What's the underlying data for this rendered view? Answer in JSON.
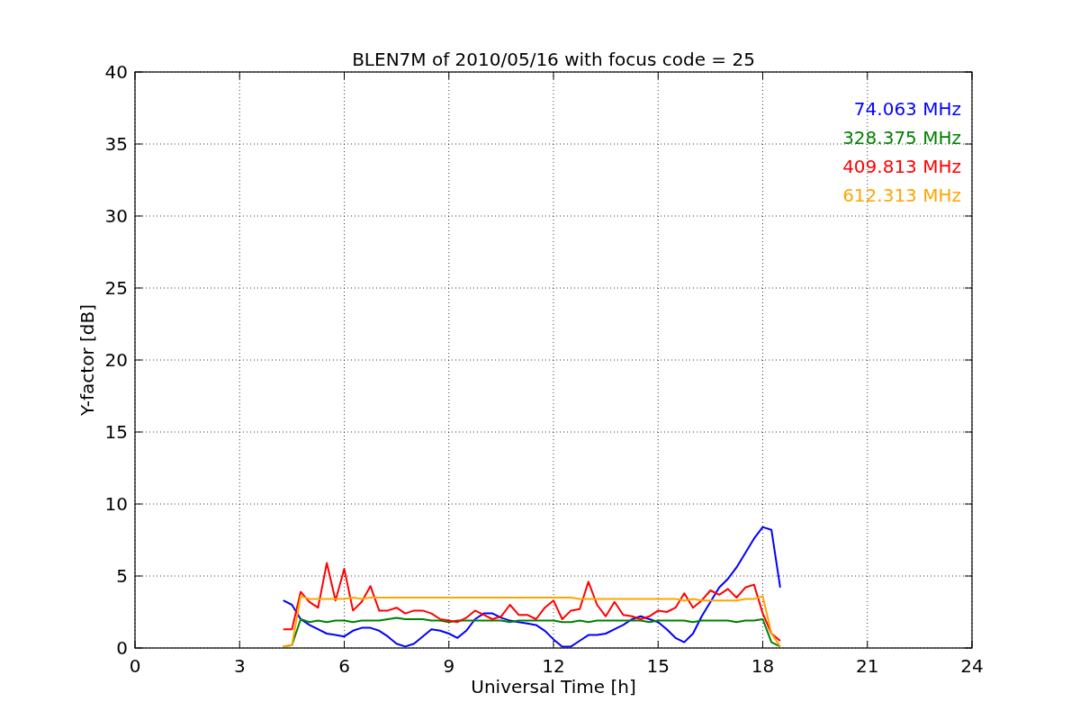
{
  "chart_data": {
    "type": "line",
    "title": "BLEN7M of 2010/05/16 with focus code = 25",
    "xlabel": "Universal Time [h]",
    "ylabel": "Y-factor [dB]",
    "xlim": [
      0,
      24
    ],
    "ylim": [
      0,
      40
    ],
    "xticks": [
      0,
      3,
      6,
      9,
      12,
      15,
      18,
      21,
      24
    ],
    "yticks": [
      0,
      5,
      10,
      15,
      20,
      25,
      30,
      35,
      40
    ],
    "grid": true,
    "x": [
      4.25,
      4.5,
      4.75,
      5,
      5.25,
      5.5,
      5.75,
      6,
      6.25,
      6.5,
      6.75,
      7,
      7.25,
      7.5,
      7.75,
      8,
      8.25,
      8.5,
      8.75,
      9,
      9.25,
      9.5,
      9.75,
      10,
      10.25,
      10.5,
      10.75,
      11,
      11.25,
      11.5,
      11.75,
      12,
      12.25,
      12.5,
      12.75,
      13,
      13.25,
      13.5,
      13.75,
      14,
      14.25,
      14.5,
      14.75,
      15,
      15.25,
      15.5,
      15.75,
      16,
      16.25,
      16.5,
      16.75,
      17,
      17.25,
      17.5,
      17.75,
      18,
      18.25,
      18.5
    ],
    "series": [
      {
        "name": "74.063 MHz",
        "color": "#0000ff",
        "values": [
          3.3,
          3.0,
          2.0,
          1.6,
          1.3,
          1.0,
          0.9,
          0.8,
          1.2,
          1.4,
          1.4,
          1.2,
          0.8,
          0.3,
          0.1,
          0.3,
          0.8,
          1.3,
          1.2,
          1.0,
          0.7,
          1.2,
          2.0,
          2.4,
          2.4,
          2.1,
          1.9,
          1.8,
          1.7,
          1.6,
          1.2,
          0.6,
          0.1,
          0.1,
          0.5,
          0.9,
          0.9,
          1.0,
          1.3,
          1.6,
          2.0,
          2.2,
          2.0,
          1.8,
          1.3,
          0.7,
          0.4,
          1.0,
          2.2,
          3.2,
          4.2,
          4.8,
          5.6,
          6.6,
          7.6,
          8.4,
          8.2,
          4.2
        ]
      },
      {
        "name": "328.375 MHz",
        "color": "#008000",
        "values": [
          0.1,
          0.2,
          2.0,
          1.8,
          1.9,
          1.8,
          1.9,
          1.9,
          1.8,
          1.9,
          1.9,
          1.9,
          2.0,
          2.1,
          2.0,
          2.0,
          2.0,
          1.9,
          1.9,
          1.8,
          1.9,
          1.9,
          1.9,
          1.9,
          1.9,
          1.9,
          1.8,
          1.9,
          1.9,
          1.9,
          1.9,
          1.9,
          1.8,
          1.8,
          1.9,
          1.8,
          1.9,
          1.9,
          1.9,
          1.9,
          1.9,
          1.9,
          1.8,
          1.9,
          1.9,
          1.9,
          1.9,
          1.8,
          1.9,
          1.9,
          1.9,
          1.9,
          1.8,
          1.9,
          1.9,
          2.0,
          0.4,
          0.1
        ]
      },
      {
        "name": "409.813 MHz",
        "color": "#ff0000",
        "values": [
          1.3,
          1.3,
          3.9,
          3.2,
          2.8,
          5.9,
          3.3,
          5.5,
          2.6,
          3.2,
          4.3,
          2.6,
          2.6,
          2.8,
          2.4,
          2.6,
          2.6,
          2.4,
          2.0,
          1.9,
          1.8,
          2.1,
          2.6,
          2.3,
          2.0,
          2.2,
          3.0,
          2.3,
          2.3,
          2.0,
          2.8,
          3.3,
          2.0,
          2.6,
          2.7,
          4.6,
          3.0,
          2.2,
          3.2,
          2.3,
          2.2,
          2.0,
          2.2,
          2.6,
          2.5,
          2.8,
          3.8,
          2.8,
          3.3,
          4.0,
          3.7,
          4.1,
          3.5,
          4.2,
          4.4,
          2.4,
          1.0,
          0.5
        ]
      },
      {
        "name": "612.313 MHz",
        "color": "#ffa500",
        "values": [
          0.1,
          0.2,
          3.6,
          3.4,
          3.4,
          3.4,
          3.4,
          3.4,
          3.5,
          3.4,
          3.5,
          3.5,
          3.5,
          3.5,
          3.5,
          3.5,
          3.5,
          3.5,
          3.5,
          3.5,
          3.5,
          3.5,
          3.5,
          3.5,
          3.5,
          3.5,
          3.5,
          3.5,
          3.5,
          3.5,
          3.5,
          3.5,
          3.5,
          3.5,
          3.4,
          3.4,
          3.4,
          3.4,
          3.4,
          3.4,
          3.4,
          3.4,
          3.4,
          3.4,
          3.4,
          3.4,
          3.3,
          3.4,
          3.3,
          3.3,
          3.3,
          3.3,
          3.3,
          3.4,
          3.4,
          3.6,
          1.0,
          0.1
        ]
      }
    ]
  }
}
